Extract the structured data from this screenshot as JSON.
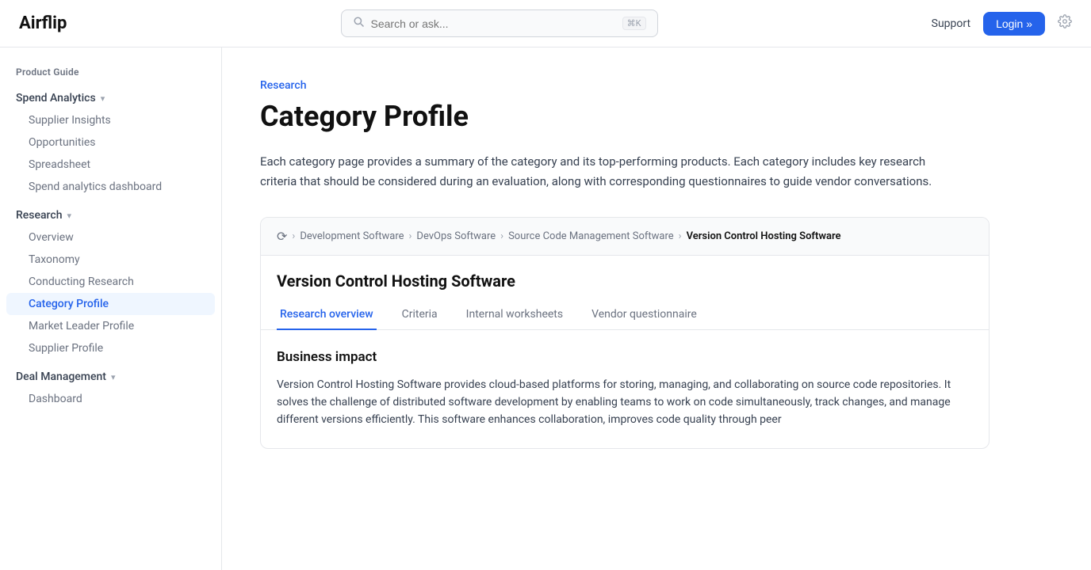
{
  "header": {
    "logo": "Airflip",
    "search": {
      "placeholder": "Search or ask...",
      "kbd": "⌘K"
    },
    "support_label": "Support",
    "login_label": "Login »"
  },
  "sidebar": {
    "product_guide_label": "Product Guide",
    "groups": [
      {
        "id": "spend-analytics",
        "label": "Spend Analytics",
        "expanded": true,
        "items": [
          {
            "id": "supplier-insights",
            "label": "Supplier Insights",
            "active": false
          },
          {
            "id": "opportunities",
            "label": "Opportunities",
            "active": false
          },
          {
            "id": "spreadsheet",
            "label": "Spreadsheet",
            "active": false
          },
          {
            "id": "spend-analytics-dashboard",
            "label": "Spend analytics dashboard",
            "active": false
          }
        ]
      },
      {
        "id": "research",
        "label": "Research",
        "expanded": true,
        "items": [
          {
            "id": "overview",
            "label": "Overview",
            "active": false
          },
          {
            "id": "taxonomy",
            "label": "Taxonomy",
            "active": false
          },
          {
            "id": "conducting-research",
            "label": "Conducting Research",
            "active": false
          },
          {
            "id": "category-profile",
            "label": "Category Profile",
            "active": true
          },
          {
            "id": "market-leader-profile",
            "label": "Market Leader Profile",
            "active": false
          },
          {
            "id": "supplier-profile",
            "label": "Supplier Profile",
            "active": false
          }
        ]
      },
      {
        "id": "deal-management",
        "label": "Deal Management",
        "expanded": true,
        "items": [
          {
            "id": "dashboard",
            "label": "Dashboard",
            "active": false
          }
        ]
      }
    ]
  },
  "main": {
    "breadcrumb": "Research",
    "page_title": "Category Profile",
    "description": "Each category page provides a summary of the category and its top-performing products. Each category includes key research criteria that should be considered during an evaluation, along with corresponding questionnaires to guide vendor conversations.",
    "card": {
      "breadcrumb": {
        "icon": "🔄",
        "items": [
          {
            "label": "Development Software",
            "active": false
          },
          {
            "label": "DevOps Software",
            "active": false
          },
          {
            "label": "Source Code Management Software",
            "active": false
          },
          {
            "label": "Version Control Hosting Software",
            "active": true
          }
        ]
      },
      "title": "Version Control Hosting Software",
      "tabs": [
        {
          "id": "research-overview",
          "label": "Research overview",
          "active": true
        },
        {
          "id": "criteria",
          "label": "Criteria",
          "active": false
        },
        {
          "id": "internal-worksheets",
          "label": "Internal worksheets",
          "active": false
        },
        {
          "id": "vendor-questionnaire",
          "label": "Vendor questionnaire",
          "active": false
        }
      ],
      "section_title": "Business impact",
      "section_text": "Version Control Hosting Software provides cloud-based platforms for storing, managing, and collaborating on source code repositories. It solves the challenge of distributed software development by enabling teams to work on code simultaneously, track changes, and manage different versions efficiently. This software enhances collaboration, improves code quality through peer"
    }
  }
}
